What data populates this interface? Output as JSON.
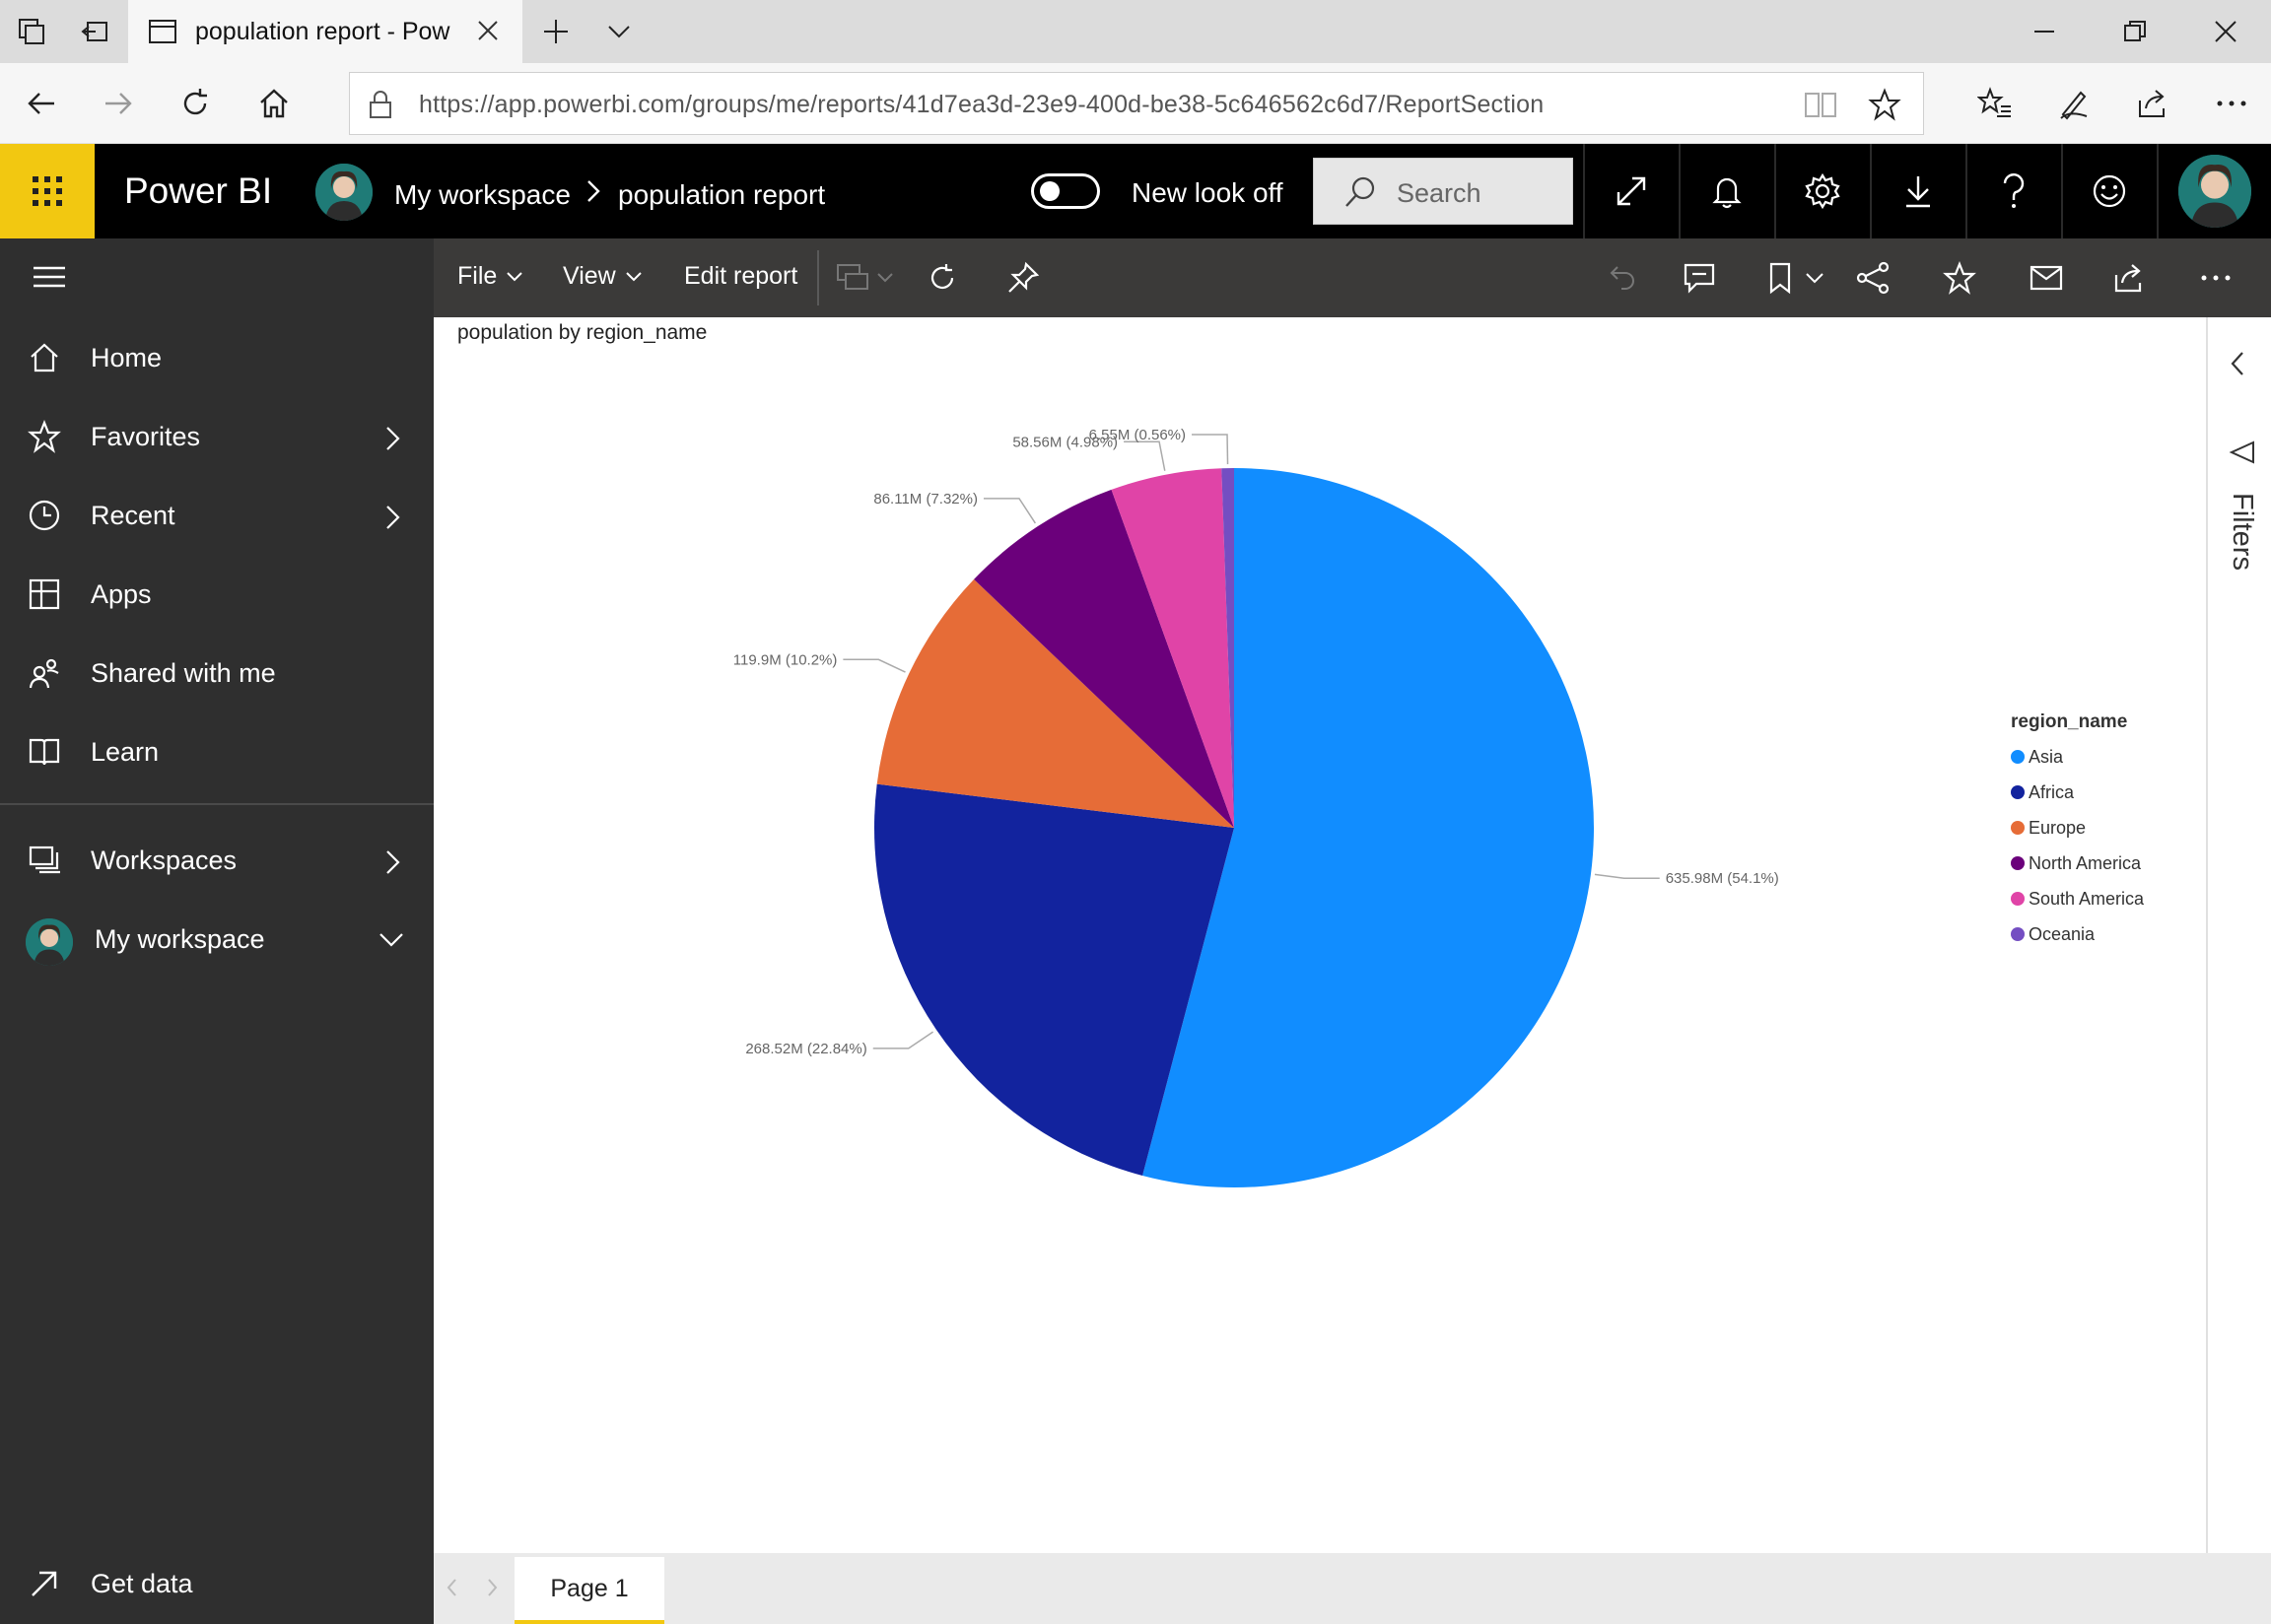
{
  "browser": {
    "tab_title": "population report - Pow",
    "url": "https://app.powerbi.com/groups/me/reports/41d7ea3d-23e9-400d-be38-5c646562c6d7/ReportSection"
  },
  "header": {
    "app_name": "Power BI",
    "breadcrumb": {
      "workspace": "My workspace",
      "report": "population report"
    },
    "new_look_label": "New look off",
    "new_look_enabled": false,
    "search_placeholder": "Search"
  },
  "nav": {
    "items": [
      {
        "label": "Home",
        "icon": "home-icon"
      },
      {
        "label": "Favorites",
        "icon": "star-icon"
      },
      {
        "label": "Recent",
        "icon": "clock-icon"
      },
      {
        "label": "Apps",
        "icon": "apps-icon"
      },
      {
        "label": "Shared with me",
        "icon": "shared-icon"
      },
      {
        "label": "Learn",
        "icon": "book-icon"
      },
      {
        "label": "Workspaces",
        "icon": "workspaces-icon"
      },
      {
        "label": "My workspace",
        "icon": "avatar"
      }
    ],
    "get_data": "Get data"
  },
  "toolbar": {
    "file": "File",
    "view": "View",
    "edit_report": "Edit report"
  },
  "visual": {
    "title": "population by region_name"
  },
  "chart_data": {
    "type": "pie",
    "title": "population by region_name",
    "legend_title": "region_name",
    "legend_position": "right",
    "categories": [
      "Asia",
      "Africa",
      "Europe",
      "North America",
      "South America",
      "Oceania"
    ],
    "values": [
      635.98,
      268.52,
      119.9,
      86.11,
      58.56,
      6.55
    ],
    "unit": "M",
    "data_labels": [
      "635.98M (54.1%)",
      "268.52M (22.84%)",
      "119.9M (10.2%)",
      "86.11M (7.32%)",
      "58.56M (4.98%)",
      "6.55M (0.56%)"
    ],
    "colors": [
      "#118DFF",
      "#12239E",
      "#E66C37",
      "#6B007B",
      "#E044A7",
      "#744EC2"
    ]
  },
  "filters": {
    "label": "Filters"
  },
  "pages": {
    "tabs": [
      "Page 1"
    ]
  }
}
